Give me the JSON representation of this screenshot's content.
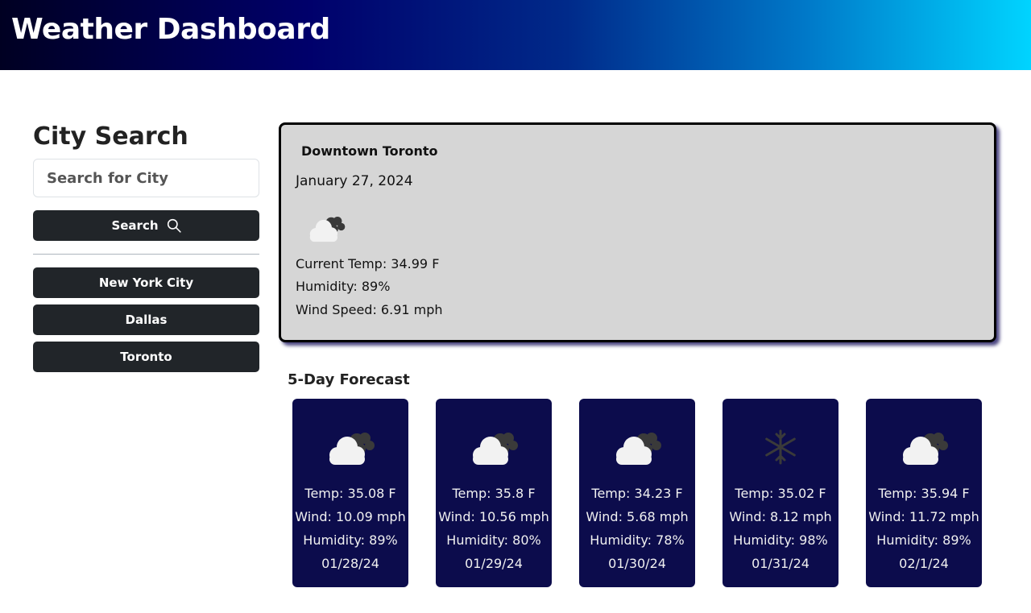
{
  "header": {
    "title": "Weather Dashboard"
  },
  "sidebar": {
    "title": "City Search",
    "search": {
      "placeholder": "Search for City",
      "value": ""
    },
    "search_button": {
      "label": "Search",
      "icon": "search-icon"
    },
    "history": [
      {
        "label": "New York City"
      },
      {
        "label": "Dallas"
      },
      {
        "label": "Toronto"
      }
    ]
  },
  "current": {
    "city": "Downtown Toronto",
    "date": "January 27, 2024",
    "icon": "cloud-icon",
    "temp": "Current Temp: 34.99 F",
    "humidity": "Humidity: 89%",
    "wind": "Wind Speed: 6.91 mph"
  },
  "forecast": {
    "title": "5-Day Forecast",
    "days": [
      {
        "icon": "cloud-icon",
        "temp": "Temp: 35.08 F",
        "wind": "Wind: 10.09 mph",
        "humidity": "Humidity: 89%",
        "date": "01/28/24"
      },
      {
        "icon": "cloud-icon",
        "temp": "Temp: 35.8 F",
        "wind": "Wind: 10.56 mph",
        "humidity": "Humidity: 80%",
        "date": "01/29/24"
      },
      {
        "icon": "cloud-icon",
        "temp": "Temp: 34.23 F",
        "wind": "Wind: 5.68 mph",
        "humidity": "Humidity: 78%",
        "date": "01/30/24"
      },
      {
        "icon": "snowflake-icon",
        "temp": "Temp: 35.02 F",
        "wind": "Wind: 8.12 mph",
        "humidity": "Humidity: 98%",
        "date": "01/31/24"
      },
      {
        "icon": "cloud-icon",
        "temp": "Temp: 35.94 F",
        "wind": "Wind: 11.72 mph",
        "humidity": "Humidity: 89%",
        "date": "02/1/24"
      }
    ]
  },
  "colors": {
    "card_dark": "#0c0c4c",
    "button_dark": "#212529",
    "current_bg": "#d6d6d6"
  }
}
